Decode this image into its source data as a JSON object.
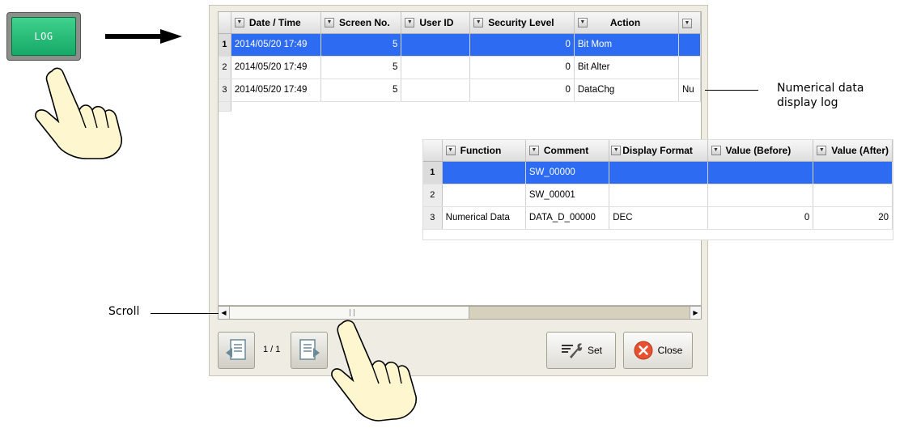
{
  "log_button": {
    "label": "LOG"
  },
  "main_grid": {
    "columns": [
      "Date / Time",
      "Screen No.",
      "User ID",
      "Security Level",
      "Action"
    ],
    "rows": [
      {
        "num": "1",
        "date": "2014/05/20 17:49",
        "screen": "5",
        "user": "",
        "security": "0",
        "action": "Bit Mom",
        "extra": ""
      },
      {
        "num": "2",
        "date": "2014/05/20 17:49",
        "screen": "5",
        "user": "",
        "security": "0",
        "action": "Bit Alter",
        "extra": ""
      },
      {
        "num": "3",
        "date": "2014/05/20 17:49",
        "screen": "5",
        "user": "",
        "security": "0",
        "action": "DataChg",
        "extra": "Nu"
      }
    ]
  },
  "sub_grid": {
    "columns": [
      "Function",
      "Comment",
      "Display Format",
      "Value (Before)",
      "Value (After)"
    ],
    "rows": [
      {
        "num": "1",
        "function": "",
        "comment": "SW_00000",
        "format": "",
        "before": "",
        "after": ""
      },
      {
        "num": "2",
        "function": "",
        "comment": "SW_00001",
        "format": "",
        "before": "",
        "after": ""
      },
      {
        "num": "3",
        "function": "Numerical Data",
        "comment": "DATA_D_00000",
        "format": "DEC",
        "before": "0",
        "after": "20"
      }
    ]
  },
  "pagination": {
    "label": "1 / 1"
  },
  "buttons": {
    "set": "Set",
    "close": "Close"
  },
  "annotations": {
    "numerical_line1": "Numerical data",
    "numerical_line2": "display log",
    "scroll": "Scroll"
  },
  "colors": {
    "selection": "#2d6bf2",
    "log_green": "#16a866"
  },
  "icons": [
    "arrow-right-icon",
    "pointing-hand-icon",
    "page-prev-icon",
    "page-next-icon",
    "wrench-icon",
    "close-x-icon",
    "dropdown-icon"
  ]
}
